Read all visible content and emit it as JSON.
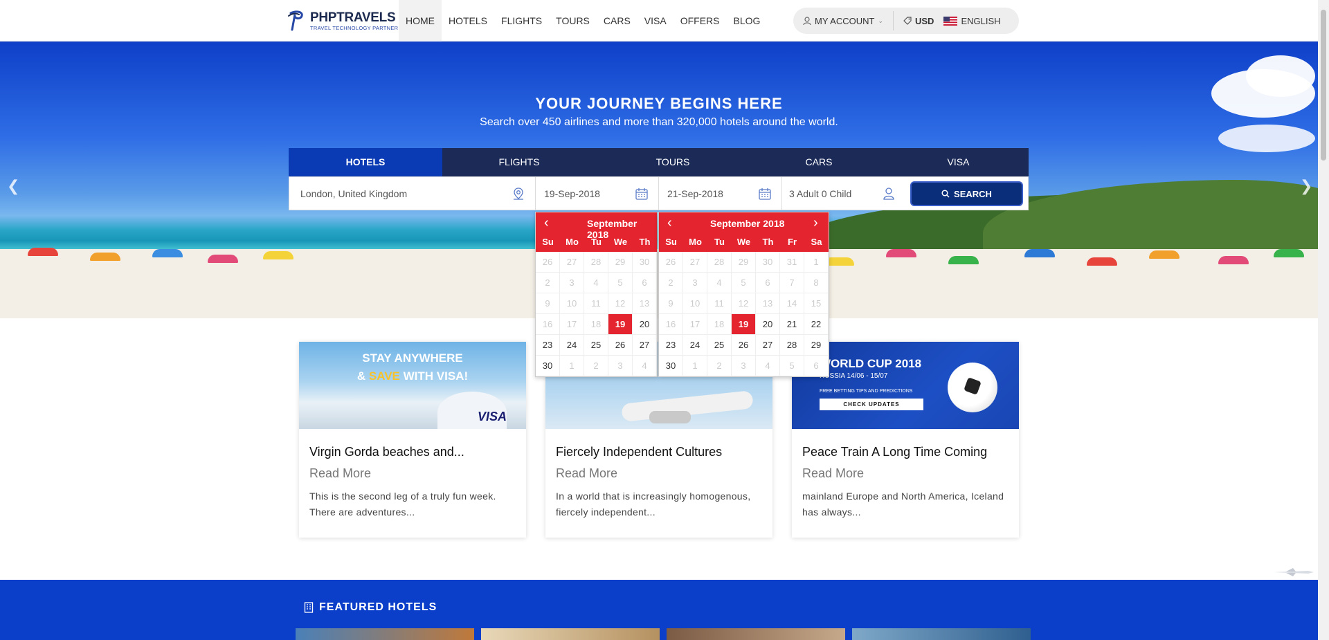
{
  "header": {
    "logo_name": "PHPTRAVELS",
    "logo_tagline": "TRAVEL TECHNOLOGY PARTNER",
    "nav": [
      "HOME",
      "HOTELS",
      "FLIGHTS",
      "TOURS",
      "CARS",
      "VISA",
      "OFFERS",
      "BLOG"
    ],
    "account": "MY ACCOUNT",
    "currency": "USD",
    "language": "ENGLISH"
  },
  "hero": {
    "title": "YOUR JOURNEY BEGINS HERE",
    "subtitle": "Search over 450 airlines and more than 320,000 hotels around the world."
  },
  "search": {
    "tabs": [
      "HOTELS",
      "FLIGHTS",
      "TOURS",
      "CARS",
      "VISA"
    ],
    "active_tab": "HOTELS",
    "location": "London, United Kingdom",
    "checkin": "19-Sep-2018",
    "checkout": "21-Sep-2018",
    "guests": "3 Adult 0 Child",
    "button": "SEARCH"
  },
  "calendar_left": {
    "title": "September 2018",
    "dow": [
      "Su",
      "Mo",
      "Tu",
      "We",
      "Th"
    ],
    "days": [
      [
        "26",
        "27",
        "28",
        "29",
        "30"
      ],
      [
        "2",
        "3",
        "4",
        "5",
        "6"
      ],
      [
        "9",
        "10",
        "11",
        "12",
        "13"
      ],
      [
        "16",
        "17",
        "18",
        "19",
        "20"
      ],
      [
        "23",
        "24",
        "25",
        "26",
        "27"
      ],
      [
        "30",
        "1",
        "2",
        "3",
        "4"
      ]
    ],
    "selected": "19"
  },
  "calendar_right": {
    "title": "September 2018",
    "dow": [
      "Su",
      "Mo",
      "Tu",
      "We",
      "Th",
      "Fr",
      "Sa"
    ],
    "days": [
      [
        "26",
        "27",
        "28",
        "29",
        "30",
        "31",
        "1"
      ],
      [
        "2",
        "3",
        "4",
        "5",
        "6",
        "7",
        "8"
      ],
      [
        "9",
        "10",
        "11",
        "12",
        "13",
        "14",
        "15"
      ],
      [
        "16",
        "17",
        "18",
        "19",
        "20",
        "21",
        "22"
      ],
      [
        "23",
        "24",
        "25",
        "26",
        "27",
        "28",
        "29"
      ],
      [
        "30",
        "1",
        "2",
        "3",
        "4",
        "5",
        "6"
      ]
    ],
    "selected": "19"
  },
  "cards": [
    {
      "banner_line1": "STAY ANYWHERE",
      "banner_line2a": "& ",
      "banner_line2b": "SAVE",
      "banner_line2c": " WITH VISA!",
      "banner_logo": "VISA",
      "title": "Virgin Gorda beaches and...",
      "more": "Read More",
      "text": "This is the second leg of a truly fun week. There are adventures..."
    },
    {
      "title": "Fiercely Independent Cultures",
      "more": "Read More",
      "text": "In a world that is increasingly homogenous, fiercely independent..."
    },
    {
      "banner_title": "WORLD CUP 2018",
      "banner_sub": "RUSSIA 14/06 - 15/07",
      "banner_note": "FREE BETTING TIPS AND PREDICTIONS",
      "banner_button": "CHECK UPDATES",
      "title": "Peace Train A Long Time Coming",
      "more": "Read More",
      "text": " mainland Europe and North America, Iceland has always..."
    }
  ],
  "featured": {
    "title": "FEATURED HOTELS"
  },
  "colors": {
    "brand_blue": "#0b3ec9",
    "accent_red": "#e4242f",
    "dark_nav": "#1b2a57"
  }
}
